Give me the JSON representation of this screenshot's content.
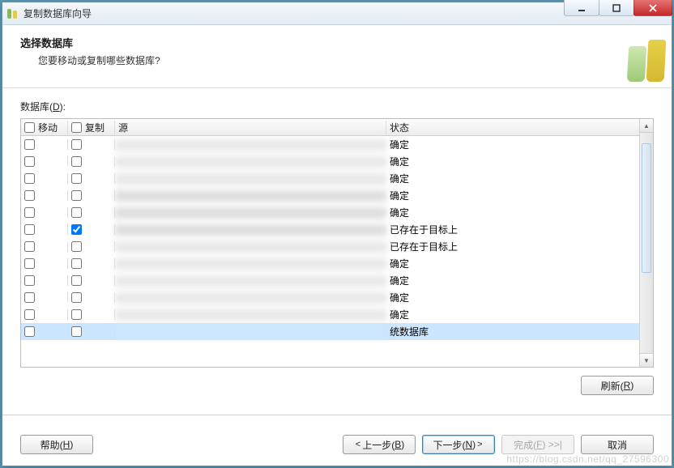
{
  "window": {
    "title": "复制数据库向导"
  },
  "header": {
    "title": "选择数据库",
    "subtitle": "您要移动或复制哪些数据库?"
  },
  "list": {
    "label_prefix": "数据库(",
    "label_hotkey": "D",
    "label_suffix": "):",
    "columns": {
      "move": "移动",
      "copy": "复制",
      "source": "源",
      "status": "状态"
    },
    "rows": [
      {
        "move": false,
        "copy": false,
        "status": "确定",
        "selected": false
      },
      {
        "move": false,
        "copy": false,
        "status": "确定",
        "selected": false
      },
      {
        "move": false,
        "copy": false,
        "status": "确定",
        "selected": false
      },
      {
        "move": false,
        "copy": false,
        "status": "确定",
        "selected": false
      },
      {
        "move": false,
        "copy": false,
        "status": "确定",
        "selected": false
      },
      {
        "move": false,
        "copy": true,
        "status": "已存在于目标上",
        "selected": false
      },
      {
        "move": false,
        "copy": false,
        "status": "已存在于目标上",
        "selected": false
      },
      {
        "move": false,
        "copy": false,
        "status": "确定",
        "selected": false
      },
      {
        "move": false,
        "copy": false,
        "status": "确定",
        "selected": false
      },
      {
        "move": false,
        "copy": false,
        "status": "确定",
        "selected": false
      },
      {
        "move": false,
        "copy": false,
        "status": "确定",
        "selected": false
      },
      {
        "move": false,
        "copy": false,
        "status": "统数据库",
        "selected": true
      }
    ]
  },
  "buttons": {
    "refresh_pre": "刷新(",
    "refresh_hot": "R",
    "refresh_suf": ")",
    "help_pre": "帮助(",
    "help_hot": "H",
    "help_suf": ")",
    "back_pre": "上一步(",
    "back_hot": "B",
    "back_suf": ")",
    "next_pre": "下一步(",
    "next_hot": "N",
    "next_suf": ")",
    "finish_pre": "完成(",
    "finish_hot": "F",
    "finish_suf": ") >>|",
    "cancel": "取消"
  },
  "watermark": "https://blog.csdn.net/qq_27596300"
}
